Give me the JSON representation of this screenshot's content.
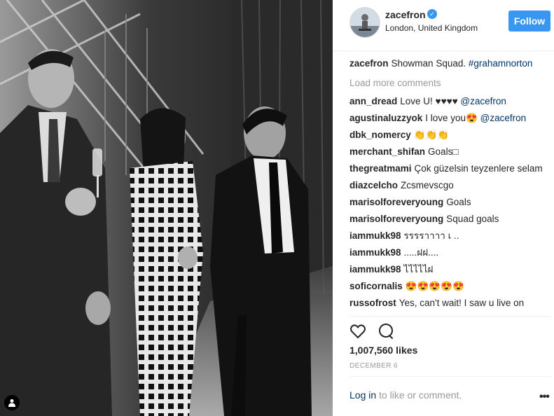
{
  "post": {
    "author": {
      "username": "zacefron",
      "location": "London, United Kingdom",
      "verified_icon": "verified-badge-icon",
      "follow_label": "Follow"
    },
    "caption": {
      "user": "zacefron",
      "text": "Showman Squad. ",
      "hashtag": "#grahamnorton"
    },
    "load_more_label": "Load more comments",
    "comments": [
      {
        "user": "ann_dread",
        "text": "Love U! ♥♥♥♥ ",
        "mention": "@zacefron"
      },
      {
        "user": "agustinaluzzyok",
        "text": "I love you😍 ",
        "mention": "@zacefron"
      },
      {
        "user": "dbk_nomercy",
        "text": "👏👏👏",
        "mention": ""
      },
      {
        "user": "merchant_shifan",
        "text": "Goals□",
        "mention": ""
      },
      {
        "user": "thegreatmami",
        "text": "Çok güzelsin teyzenlere selam",
        "mention": ""
      },
      {
        "user": "diazcelcho",
        "text": "Zcsmevscgo",
        "mention": ""
      },
      {
        "user": "marisolforeveryoung",
        "text": "Goals",
        "mention": ""
      },
      {
        "user": "marisolforeveryoung",
        "text": "Squad goals",
        "mention": ""
      },
      {
        "user": "iammukk98",
        "text": "รรรราาาา เ ..",
        "mention": ""
      },
      {
        "user": "iammukk98",
        "text": ".....ฝฝ....",
        "mention": ""
      },
      {
        "user": "iammukk98",
        "text": "ไไไไไฝ",
        "mention": ""
      },
      {
        "user": "soficornalis",
        "text": "😍😍😍😍😍",
        "mention": ""
      },
      {
        "user": "russofrost",
        "text": "Yes, can't wait! I saw u live on",
        "mention": ""
      }
    ],
    "likes": "1,007,560 likes",
    "date": "DECEMBER 6",
    "login": {
      "link": "Log in",
      "rest": " to like or comment."
    },
    "icons": {
      "like": "heart-icon",
      "comment": "comment-icon",
      "more": "more-options-icon",
      "tag": "user-tag-icon"
    },
    "colors": {
      "accent": "#3897f0",
      "link": "#003569",
      "muted": "#999999"
    }
  }
}
